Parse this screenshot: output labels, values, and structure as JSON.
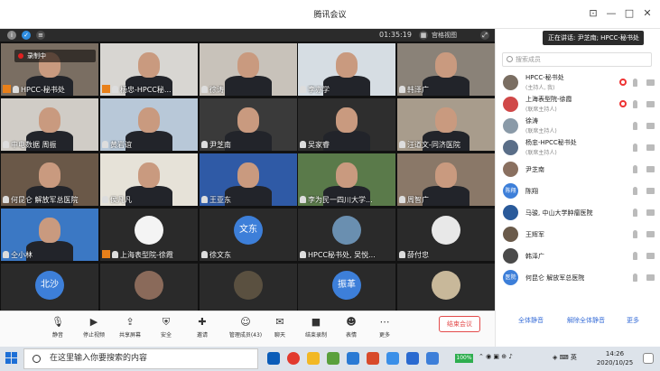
{
  "window": {
    "title": "腾讯会议"
  },
  "status_bar": {
    "timer": "01:35:19",
    "view_mode": "宫格视图",
    "recording": "录制中"
  },
  "speaking": {
    "text": "正在讲话: 尹芝南; HPCC-秘书处"
  },
  "tiles": [
    {
      "name": "HPCC-秘书处",
      "kind": "video",
      "bg": "#7a6e62",
      "host": true
    },
    {
      "name": "杨忠-HPCC秘...",
      "kind": "video",
      "bg": "#d8d6d2",
      "host": true
    },
    {
      "name": "徐涛",
      "kind": "video",
      "bg": "#c8c2ba",
      "host": false
    },
    {
      "name": "李亦学",
      "kind": "video",
      "bg": "#d6dde3",
      "host": false
    },
    {
      "name": "韩泽广",
      "kind": "video",
      "bg": "#8a8278",
      "host": false
    },
    {
      "name": "中电数据 周振",
      "kind": "video",
      "bg": "#d0ccc6",
      "host": false
    },
    {
      "name": "黄岩谊",
      "kind": "video",
      "bg": "#b8c8d8",
      "host": false
    },
    {
      "name": "尹芝南",
      "kind": "video",
      "bg": "#3a3a3a",
      "host": false
    },
    {
      "name": "吴家睿",
      "kind": "video",
      "bg": "#2e2e2e",
      "host": false
    },
    {
      "name": "汪道文-同济医院",
      "kind": "video",
      "bg": "#a89c8c",
      "host": false
    },
    {
      "name": "何昆仑 解放军总医院",
      "kind": "video",
      "bg": "#6a5848",
      "host": false
    },
    {
      "name": "侯凡凡",
      "kind": "video",
      "bg": "#e6e2d8",
      "host": false
    },
    {
      "name": "王亚东",
      "kind": "video",
      "bg": "#2f5aa6",
      "host": false
    },
    {
      "name": "李为民一四川大学...",
      "kind": "video",
      "bg": "#5a7a4a",
      "host": false
    },
    {
      "name": "周智广",
      "kind": "video",
      "bg": "#8a7868",
      "host": false
    },
    {
      "name": "仝小林",
      "kind": "video",
      "bg": "#3b78c4",
      "host": false
    },
    {
      "name": "上海表型院-徐霞",
      "kind": "avatar",
      "bg": "#2a2a2a",
      "avatar_bg": "#f4f4f4",
      "avatar_text": "",
      "host": true
    },
    {
      "name": "徐文东",
      "kind": "avatar",
      "bg": "#2a2a2a",
      "avatar_bg": "#3d7fd9",
      "avatar_text": "文东",
      "host": false
    },
    {
      "name": "HPCC秘书处, 吴悦...",
      "kind": "avatar",
      "bg": "#2a2a2a",
      "avatar_bg": "#6a8fb0",
      "avatar_text": "",
      "host": false
    },
    {
      "name": "薛付忠",
      "kind": "avatar",
      "bg": "#2a2a2a",
      "avatar_bg": "#e8e8e8",
      "avatar_text": "",
      "host": false
    },
    {
      "name": "",
      "kind": "avatar",
      "bg": "#2a2a2a",
      "avatar_bg": "#3d7fd9",
      "avatar_text": "北沙",
      "host": false
    },
    {
      "name": "",
      "kind": "avatar",
      "bg": "#2a2a2a",
      "avatar_bg": "#8a6a5a",
      "avatar_text": "",
      "host": false
    },
    {
      "name": "",
      "kind": "avatar",
      "bg": "#2a2a2a",
      "avatar_bg": "#5a5040",
      "avatar_text": "",
      "host": false
    },
    {
      "name": "",
      "kind": "avatar",
      "bg": "#2a2a2a",
      "avatar_bg": "#3d7fd9",
      "avatar_text": "振革",
      "host": false
    },
    {
      "name": "",
      "kind": "avatar",
      "bg": "#2a2a2a",
      "avatar_bg": "#c8b89a",
      "avatar_text": "",
      "host": false
    }
  ],
  "toolbar": {
    "items": [
      {
        "label": "静音",
        "icon": "microphone-icon"
      },
      {
        "label": "停止视频",
        "icon": "video-camera-icon"
      },
      {
        "label": "共享屏幕",
        "icon": "share-screen-icon"
      },
      {
        "label": "安全",
        "icon": "shield-icon"
      },
      {
        "label": "邀请",
        "icon": "invite-icon"
      },
      {
        "label": "管理成员(43)",
        "icon": "members-icon"
      },
      {
        "label": "聊天",
        "icon": "chat-icon"
      },
      {
        "label": "结束录制",
        "icon": "stop-record-icon"
      },
      {
        "label": "表情",
        "icon": "emoji-icon"
      },
      {
        "label": "更多",
        "icon": "more-icon"
      }
    ],
    "end_label": "结束会议"
  },
  "panel": {
    "search_placeholder": "搜索成员",
    "members": [
      {
        "name": "HPCC-秘书处",
        "sub": "(主持人, 我)",
        "avatar": "",
        "avatar_bg": "#7a6e62",
        "recording": true
      },
      {
        "name": "上海表型院-徐霞",
        "sub": "(联席主持人)",
        "avatar": "",
        "avatar_bg": "#d04848",
        "recording": true
      },
      {
        "name": "徐涛",
        "sub": "(联席主持人)",
        "avatar": "",
        "avatar_bg": "#8a9aa8",
        "recording": false
      },
      {
        "name": "杨忠-HPCC秘书处",
        "sub": "(联席主持人)",
        "avatar": "",
        "avatar_bg": "#5a6e88",
        "recording": false
      },
      {
        "name": "尹芝南",
        "sub": "",
        "avatar": "",
        "avatar_bg": "#8a7060",
        "recording": false
      },
      {
        "name": "陈翔",
        "sub": "",
        "avatar": "陈翔",
        "avatar_bg": "#3d7fd9",
        "recording": false
      },
      {
        "name": "马骏, 中山大学肿瘤医院",
        "sub": "",
        "avatar": "",
        "avatar_bg": "#2a5a9a",
        "recording": false
      },
      {
        "name": "王辉军",
        "sub": "",
        "avatar": "",
        "avatar_bg": "#6a5a4a",
        "recording": false
      },
      {
        "name": "韩泽广",
        "sub": "",
        "avatar": "",
        "avatar_bg": "#4a4a4a",
        "recording": false
      },
      {
        "name": "何昆仑 解放军总医院",
        "sub": "",
        "avatar": "医院",
        "avatar_bg": "#3d7fd9",
        "recording": false
      }
    ],
    "mute_all": "全体静音",
    "unmute_all": "解除全体静音",
    "more": "更多"
  },
  "taskbar": {
    "search_text": "在这里输入你要搜索的内容",
    "battery": "100%",
    "time": "14:26",
    "date": "2020/10/25"
  }
}
